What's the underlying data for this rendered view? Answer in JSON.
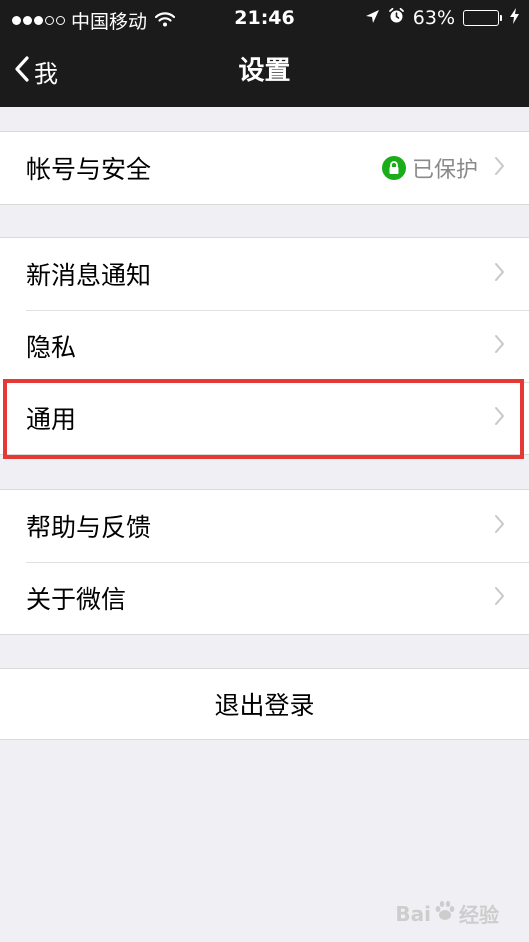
{
  "status_bar": {
    "carrier": "中国移动",
    "time": "21:46",
    "battery_percent": "63%",
    "battery_level": 0.63,
    "battery_color": "#4cd964"
  },
  "nav": {
    "back_label": "我",
    "title": "设置"
  },
  "groups": [
    {
      "items": [
        {
          "label": "帐号与安全",
          "status": "已保护",
          "status_icon": "lock-icon"
        }
      ]
    },
    {
      "items": [
        {
          "label": "新消息通知"
        },
        {
          "label": "隐私"
        },
        {
          "label": "通用",
          "highlighted": true
        }
      ]
    },
    {
      "items": [
        {
          "label": "帮助与反馈"
        },
        {
          "label": "关于微信"
        }
      ]
    }
  ],
  "logout_label": "退出登录",
  "watermark": {
    "left": "Bai",
    "right": "经验"
  },
  "colors": {
    "bar_background": "#1b1b1b",
    "page_background": "#efeff4",
    "highlight_border": "#e53935",
    "secure_badge": "#1aad19"
  }
}
